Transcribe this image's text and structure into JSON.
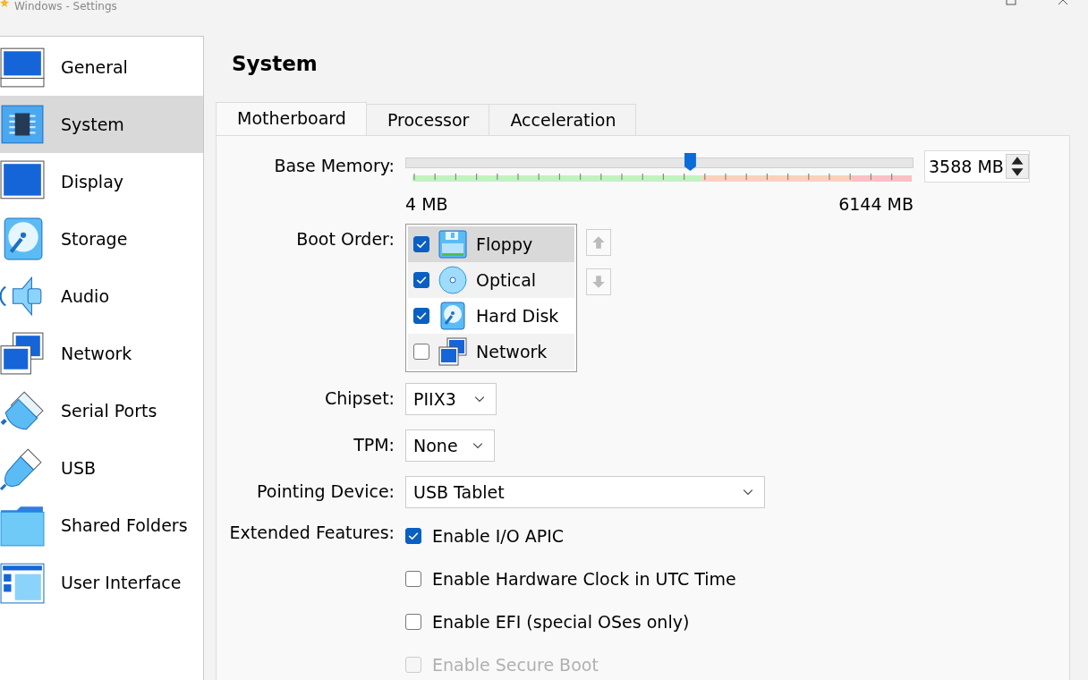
{
  "window": {
    "title": "Windows - Settings"
  },
  "sidebar": {
    "items": [
      {
        "label": "General",
        "selected": false
      },
      {
        "label": "System",
        "selected": true
      },
      {
        "label": "Display",
        "selected": false
      },
      {
        "label": "Storage",
        "selected": false
      },
      {
        "label": "Audio",
        "selected": false
      },
      {
        "label": "Network",
        "selected": false
      },
      {
        "label": "Serial Ports",
        "selected": false
      },
      {
        "label": "USB",
        "selected": false
      },
      {
        "label": "Shared Folders",
        "selected": false
      },
      {
        "label": "User Interface",
        "selected": false
      }
    ]
  },
  "page_title": "System",
  "tabs": [
    {
      "label": "Motherboard",
      "selected": true
    },
    {
      "label": "Processor",
      "selected": false
    },
    {
      "label": "Acceleration",
      "selected": false
    }
  ],
  "base_memory": {
    "label": "Base Memory:",
    "level": 0.58,
    "value": "3588 MB",
    "min_label": "4 MB",
    "max_label": "6144 MB"
  },
  "boot_order": {
    "label": "Boot Order:",
    "items": [
      {
        "kind": "floppy",
        "label": "Floppy",
        "checked": true,
        "selected": true
      },
      {
        "kind": "optical",
        "label": "Optical",
        "checked": true,
        "selected": false
      },
      {
        "kind": "hard_disk",
        "label": "Hard Disk",
        "checked": true,
        "selected": false
      },
      {
        "kind": "network",
        "label": "Network",
        "checked": false,
        "selected": false
      }
    ]
  },
  "chipset": {
    "label": "Chipset:",
    "value": "PIIX3"
  },
  "tpm": {
    "label": "TPM:",
    "value": "None"
  },
  "pointing_device": {
    "label": "Pointing Device:",
    "value": "USB Tablet"
  },
  "extended_features": {
    "label": "Extended Features:",
    "options": [
      {
        "label": "Enable I/O APIC",
        "checked": true,
        "disabled": false
      },
      {
        "label": "Enable Hardware Clock in UTC Time",
        "checked": false,
        "disabled": false
      },
      {
        "label": "Enable EFI (special OSes only)",
        "checked": false,
        "disabled": false
      },
      {
        "label": "Enable Secure Boot",
        "checked": false,
        "disabled": true
      }
    ]
  }
}
